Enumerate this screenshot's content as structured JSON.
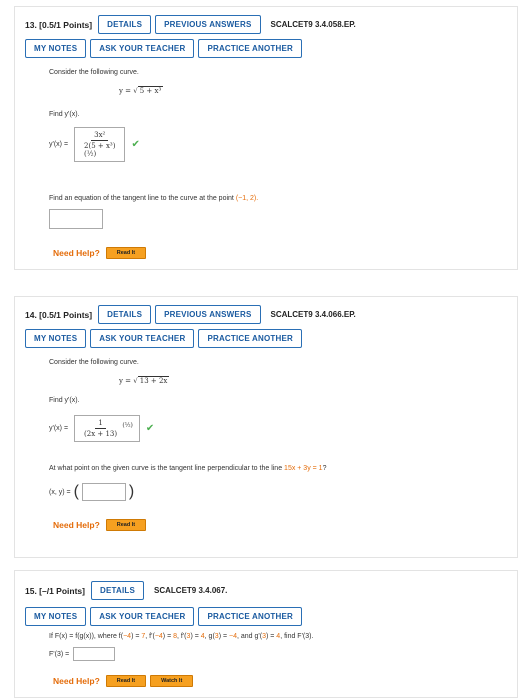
{
  "q13": {
    "number": "13.  [0.5/1 Points]",
    "buttons": [
      "DETAILS",
      "PREVIOUS ANSWERS",
      "MY NOTES",
      "ASK YOUR TEACHER",
      "PRACTICE ANOTHER"
    ],
    "code": "SCALCET9 3.4.058.EP.",
    "intro": "Consider the following curve.",
    "curve_lhs": "y = √",
    "curve_rhs": "5 + x³",
    "find": "Find y'(x).",
    "ans_label": "y'(x) =",
    "ans_num": "3x²",
    "ans_den": "2(5 + x³)",
    "ans_exp": "(½)",
    "tangent_prompt": "Find an equation of the tangent line to the curve at the point ",
    "point": "(−1, 2).",
    "help": "Need Help?",
    "read": "Read It"
  },
  "q14": {
    "number": "14.  [0.5/1 Points]",
    "buttons": [
      "DETAILS",
      "PREVIOUS ANSWERS",
      "MY NOTES",
      "ASK YOUR TEACHER",
      "PRACTICE ANOTHER"
    ],
    "code": "SCALCET9 3.4.066.EP.",
    "intro": "Consider the following curve.",
    "curve_lhs": "y = √",
    "curve_rhs": "13 + 2x",
    "find": "Find y'(x).",
    "ans_label": "y'(x) =",
    "ans_num": "1",
    "ans_den": "(2x + 13)",
    "ans_exp": "(½)",
    "perp_prompt": "At what point on the given curve is the tangent line perpendicular to the line ",
    "line": "15x + 3y = 1",
    "qmark": "?",
    "xy_label": "(x, y) =",
    "help": "Need Help?",
    "read": "Read It"
  },
  "q15": {
    "number": "15.  [–/1 Points]",
    "buttons": [
      "DETAILS",
      "MY NOTES",
      "ASK YOUR TEACHER",
      "PRACTICE ANOTHER"
    ],
    "code": "SCALCET9 3.4.067.",
    "prompt_a": "If F(x) = f(g(x)), where f(",
    "v1": "−4",
    "prompt_b": ") = ",
    "v2": "7",
    "prompt_c": ", f'(",
    "v3": "−4",
    "prompt_d": ") = ",
    "v4": "8",
    "prompt_e": ", f'(",
    "v5": "3",
    "prompt_f": ") = ",
    "v6": "4",
    "prompt_g": ", g(",
    "v7": "3",
    "prompt_h": ") = ",
    "v8": "−4",
    "prompt_i": ", and g'(",
    "v9": "3",
    "prompt_j": ") = ",
    "v10": "4",
    "prompt_k": ", find F'(",
    "v11": "3",
    "prompt_l": ").",
    "ans_label": "F'(3) =",
    "help": "Need Help?",
    "read": "Read It",
    "watch": "Watch It"
  }
}
